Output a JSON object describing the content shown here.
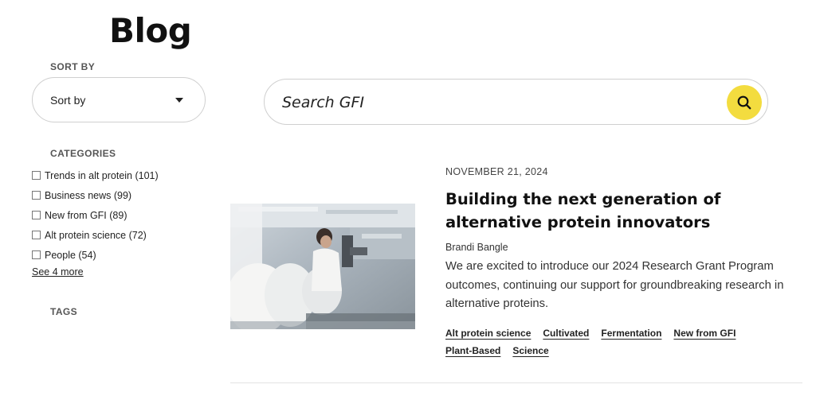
{
  "page": {
    "title": "Blog"
  },
  "sidebar": {
    "sort": {
      "heading": "SORT BY",
      "selected": "Sort by"
    },
    "categories": {
      "heading": "CATEGORIES",
      "items": [
        {
          "label": "Trends in alt protein (101)"
        },
        {
          "label": "Business news (99)"
        },
        {
          "label": "New from GFI (89)"
        },
        {
          "label": "Alt protein science (72)"
        },
        {
          "label": "People (54)"
        }
      ],
      "see_more": "See 4 more"
    },
    "tags": {
      "heading": "TAGS"
    }
  },
  "search": {
    "placeholder": "Search GFI",
    "icon": "search-icon"
  },
  "post": {
    "date": "NOVEMBER 21, 2024",
    "title": "Building the next generation of alternative protein innovators",
    "author": "Brandi Bangle",
    "excerpt": "We are excited to introduce our 2024 Research Grant Program outcomes, continuing our support for groundbreaking research in alternative proteins.",
    "tags_row1": [
      "Alt protein science",
      "Cultivated",
      "Fermentation",
      "New from GFI"
    ],
    "tags_row2": [
      "Plant-Based",
      "Science"
    ]
  },
  "colors": {
    "accent": "#f3dc3f"
  }
}
